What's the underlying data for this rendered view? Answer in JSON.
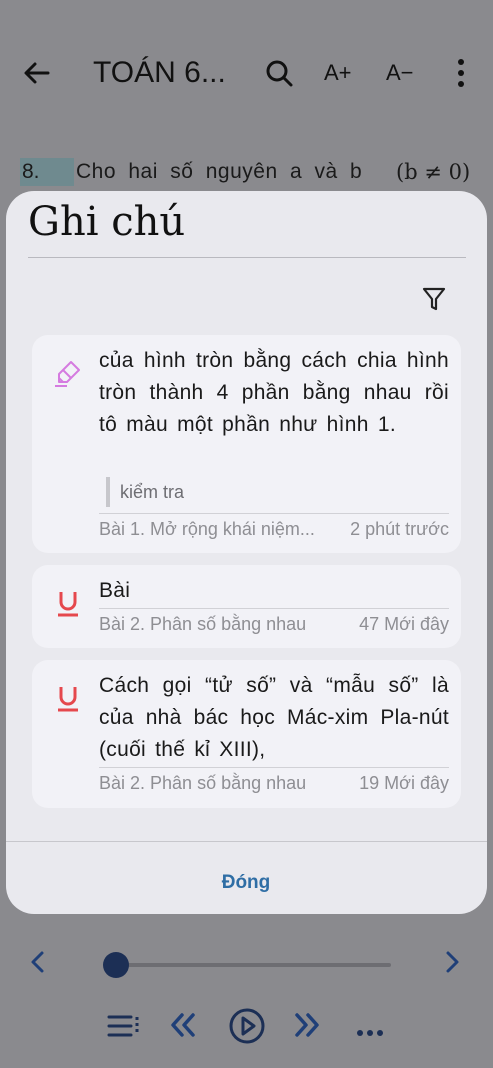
{
  "header": {
    "back_icon": "arrow-left-icon",
    "title": "TOÁN 6...",
    "search_icon": "search-icon",
    "font_increase_label": "A+",
    "font_decrease_label": "A−",
    "more_icon": "more-vertical-icon"
  },
  "reader": {
    "line_number": "8.",
    "line_text": "Cho hai số nguyên a và b",
    "line_math": "(b ≠ 0)"
  },
  "notes_dialog": {
    "title": "Ghi chú",
    "filter_icon": "filter-icon",
    "notes": [
      {
        "icon": "highlighter-icon",
        "icon_color": "#d57be0",
        "text": "của hình tròn bằng cách chia hình tròn thành 4 phần bằng nhau rồi tô màu một phần như hình 1.",
        "comment": "kiểm tra",
        "chapter": "Bài 1. Mở rộng khái niệm...",
        "time": "2 phút trước"
      },
      {
        "icon": "underline-icon",
        "icon_color": "#e5484d",
        "text": "Bài",
        "chapter": "Bài 2. Phân số bằng nhau",
        "time": "47 Mới đây"
      },
      {
        "icon": "underline-icon",
        "icon_color": "#e5484d",
        "text": "Cách gọi “tử số” và “mẫu số” là của nhà bác học Mác-xim Pla-nút (cuối thế kỉ XIII),",
        "chapter": "Bài 2. Phân số bằng nhau",
        "time": "19 Mới đây"
      }
    ],
    "close_label": "Đóng"
  },
  "player": {
    "prev_icon": "chevron-left-icon",
    "next_icon": "chevron-right-icon",
    "progress": 0.0,
    "toc_icon": "toc-list-icon",
    "rewind_icon": "double-chevron-left-icon",
    "play_icon": "play-circle-icon",
    "forward_icon": "double-chevron-right-icon",
    "more_icon": "more-horizontal-icon"
  },
  "colors": {
    "accent": "#2f6ea5",
    "nav_blue": "#1f3f78",
    "scrim": "#8a8a8e"
  }
}
